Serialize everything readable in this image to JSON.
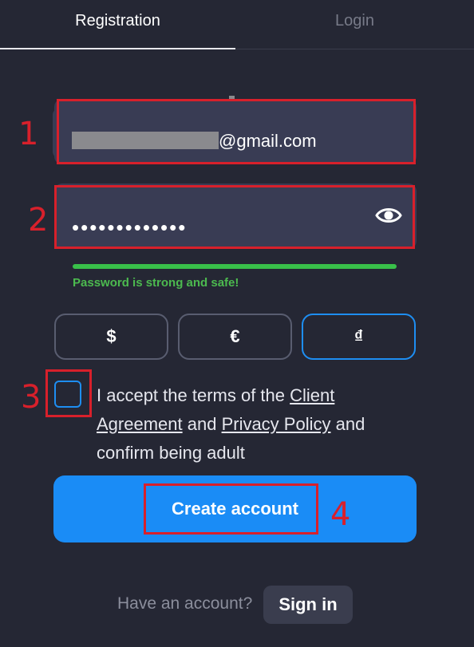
{
  "tabs": {
    "registration": "Registration",
    "login": "Login"
  },
  "email": {
    "value_suffix": "@gmail.com"
  },
  "password": {
    "masked_value": "•••••••••••••",
    "strength_message": "Password is strong and safe!"
  },
  "currencies": [
    {
      "symbol": "$"
    },
    {
      "symbol": "€"
    },
    {
      "symbol": "₫"
    }
  ],
  "terms": {
    "before": "I accept the terms of the ",
    "client_agreement": "Client Agreement",
    "middle": " and ",
    "privacy_policy": "Privacy Policy",
    "after": " and confirm being adult"
  },
  "create_button": "Create account",
  "footer": {
    "question": "Have an account?",
    "sign_in": "Sign in"
  },
  "annotations": [
    "1",
    "2",
    "3",
    "4"
  ],
  "colors": {
    "background": "#252734",
    "accent": "#1a8cf6",
    "success": "#4cba4f",
    "annotation": "#d8202b"
  },
  "icons": {
    "password_toggle": "eye-icon"
  }
}
